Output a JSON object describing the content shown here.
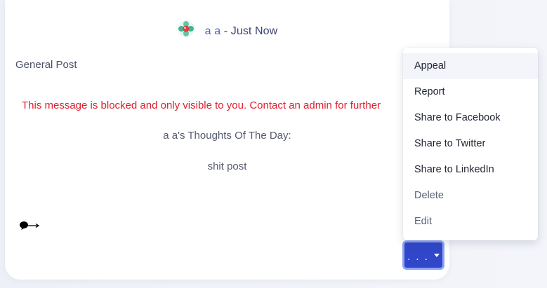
{
  "post": {
    "author": "a a",
    "separator": " - ",
    "time": "Just Now",
    "type": "General Post",
    "blocked_message": "This message is blocked and only visible to you. Contact an admin for further",
    "thoughts_title": "a a's Thoughts Of The Day:",
    "body": "shit post",
    "comment_icon": "speech-bubble-arrow-icon"
  },
  "more_button": {
    "label": ". . .",
    "icon": "caret-down-icon",
    "color": "#3047c9"
  },
  "menu": {
    "items": [
      {
        "label": "Appeal"
      },
      {
        "label": "Report"
      },
      {
        "label": "Share to Facebook"
      },
      {
        "label": "Share to Twitter"
      },
      {
        "label": "Share to LinkedIn"
      },
      {
        "label": "Delete"
      },
      {
        "label": "Edit"
      }
    ]
  },
  "colors": {
    "blocked_text": "#e01d2d",
    "author_text": "#4d62c9",
    "button_bg": "#3047c9"
  }
}
